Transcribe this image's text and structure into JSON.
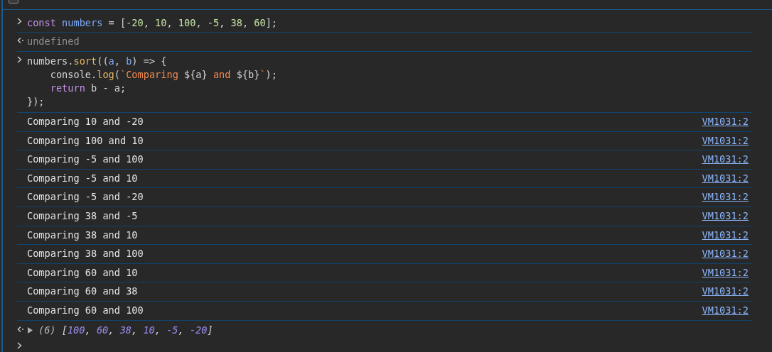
{
  "cors_option": {
    "checked": false
  },
  "entries": [
    {
      "kind": "input",
      "lines": [
        [
          {
            "text": "const",
            "kind": "keyword"
          },
          {
            "text": " numbers",
            "kind": "variable"
          },
          {
            "text": " = [",
            "kind": "plain"
          },
          {
            "text": "-20",
            "kind": "number"
          },
          {
            "text": ", ",
            "kind": "plain"
          },
          {
            "text": "10",
            "kind": "number"
          },
          {
            "text": ", ",
            "kind": "plain"
          },
          {
            "text": "100",
            "kind": "number"
          },
          {
            "text": ", ",
            "kind": "plain"
          },
          {
            "text": "-5",
            "kind": "number"
          },
          {
            "text": ", ",
            "kind": "plain"
          },
          {
            "text": "38",
            "kind": "number"
          },
          {
            "text": ", ",
            "kind": "plain"
          },
          {
            "text": "60",
            "kind": "number"
          },
          {
            "text": "];",
            "kind": "plain"
          }
        ]
      ]
    },
    {
      "kind": "result",
      "text": "undefined"
    },
    {
      "kind": "input",
      "lines": [
        [
          {
            "text": "numbers.",
            "kind": "plain"
          },
          {
            "text": "sort",
            "kind": "function"
          },
          {
            "text": "((",
            "kind": "plain"
          },
          {
            "text": "a",
            "kind": "variable"
          },
          {
            "text": ", ",
            "kind": "plain"
          },
          {
            "text": "b",
            "kind": "variable"
          },
          {
            "text": ") => {",
            "kind": "plain"
          }
        ],
        [
          {
            "text": "    console.",
            "kind": "plain"
          },
          {
            "text": "log",
            "kind": "function"
          },
          {
            "text": "(",
            "kind": "plain"
          },
          {
            "text": "`Comparing ",
            "kind": "string"
          },
          {
            "text": "${a}",
            "kind": "plain"
          },
          {
            "text": " and ",
            "kind": "string"
          },
          {
            "text": "${b}",
            "kind": "plain"
          },
          {
            "text": "`",
            "kind": "string"
          },
          {
            "text": ");",
            "kind": "plain"
          }
        ],
        [
          {
            "text": "    return",
            "kind": "keyword"
          },
          {
            "text": " b - a;",
            "kind": "plain"
          }
        ],
        [
          {
            "text": "});",
            "kind": "plain"
          }
        ]
      ]
    },
    {
      "kind": "log",
      "text": "Comparing 10 and -20",
      "source": "VM1031:2"
    },
    {
      "kind": "log",
      "text": "Comparing 100 and 10",
      "source": "VM1031:2"
    },
    {
      "kind": "log",
      "text": "Comparing -5 and 100",
      "source": "VM1031:2"
    },
    {
      "kind": "log",
      "text": "Comparing -5 and 10",
      "source": "VM1031:2"
    },
    {
      "kind": "log",
      "text": "Comparing -5 and -20",
      "source": "VM1031:2"
    },
    {
      "kind": "log",
      "text": "Comparing 38 and -5",
      "source": "VM1031:2"
    },
    {
      "kind": "log",
      "text": "Comparing 38 and 10",
      "source": "VM1031:2"
    },
    {
      "kind": "log",
      "text": "Comparing 38 and 100",
      "source": "VM1031:2"
    },
    {
      "kind": "log",
      "text": "Comparing 60 and 10",
      "source": "VM1031:2"
    },
    {
      "kind": "log",
      "text": "Comparing 60 and 38",
      "source": "VM1031:2"
    },
    {
      "kind": "log",
      "text": "Comparing 60 and 100",
      "source": "VM1031:2"
    },
    {
      "kind": "result_object",
      "expanded": false,
      "tokens": [
        {
          "text": "(6) ",
          "kind": "count"
        },
        {
          "text": "[",
          "kind": "plain"
        },
        {
          "text": "100",
          "kind": "value"
        },
        {
          "text": ", ",
          "kind": "plain"
        },
        {
          "text": "60",
          "kind": "value"
        },
        {
          "text": ", ",
          "kind": "plain"
        },
        {
          "text": "38",
          "kind": "value"
        },
        {
          "text": ", ",
          "kind": "plain"
        },
        {
          "text": "10",
          "kind": "value"
        },
        {
          "text": ", ",
          "kind": "plain"
        },
        {
          "text": "-5",
          "kind": "value"
        },
        {
          "text": ", ",
          "kind": "plain"
        },
        {
          "text": "-20",
          "kind": "value"
        },
        {
          "text": "]",
          "kind": "plain"
        }
      ]
    }
  ]
}
